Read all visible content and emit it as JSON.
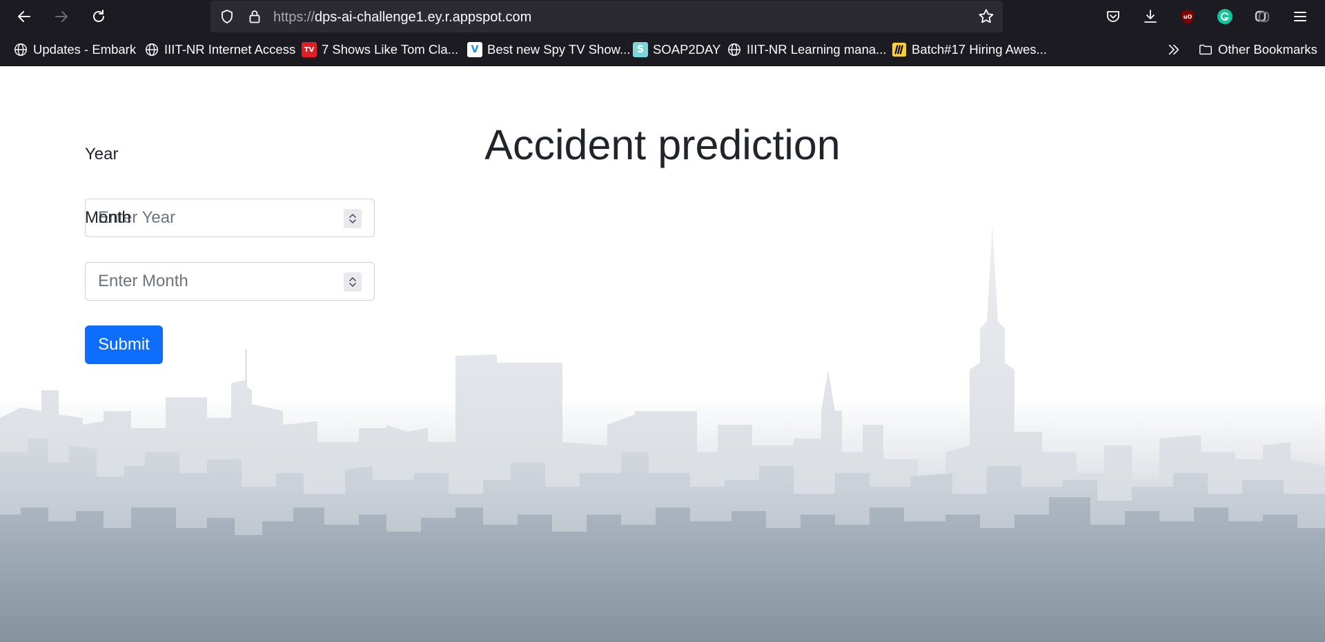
{
  "browser": {
    "url_protocol": "https://",
    "url_host": "dps-ai-challenge1.ey.r.appspot.com",
    "icons": [
      "back-icon",
      "forward-icon",
      "reload-icon",
      "shield-icon",
      "lock-icon",
      "star-icon",
      "pocket-icon",
      "download-icon",
      "ublock-icon",
      "grammarly-icon",
      "extension-icon",
      "menu-icon"
    ]
  },
  "bookmarks": {
    "items": [
      {
        "label": "Updates - Embark",
        "icon": "globe-icon"
      },
      {
        "label": "IIIT-NR Internet Access",
        "icon": "globe-icon"
      },
      {
        "label": "7 Shows Like Tom Cla...",
        "icon": "tvguide-icon",
        "badge": "TV"
      },
      {
        "label": "Best new Spy TV Show...",
        "icon": "v-logo-icon",
        "badge": "V"
      },
      {
        "label": "SOAP2DAY",
        "icon": "s-logo-icon",
        "badge": "S"
      },
      {
        "label": "IIIT-NR Learning mana...",
        "icon": "globe-icon"
      },
      {
        "label": "Batch#17 Hiring Awes...",
        "icon": "miro-icon"
      }
    ],
    "other_label": "Other Bookmarks"
  },
  "page": {
    "title": "Accident prediction",
    "year_label": "Year",
    "year_placeholder": "Enter Year",
    "month_label": "Month",
    "month_placeholder": "Enter Month",
    "submit_label": "Submit"
  },
  "colors": {
    "primary": "#0d6efd",
    "chrome_bg": "#1c1b22",
    "urlbar_bg": "#2b2a33",
    "text": "#212529"
  }
}
